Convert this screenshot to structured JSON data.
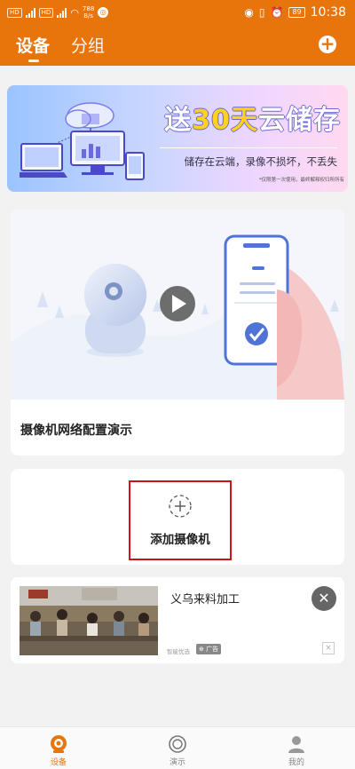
{
  "status_bar": {
    "sim1": "HD",
    "sim2": "HD",
    "net_speed_value": "788",
    "net_speed_unit": "B/s",
    "battery": "89",
    "time": "10:38"
  },
  "header": {
    "tabs": [
      {
        "label": "设备",
        "active": true
      },
      {
        "label": "分组",
        "active": false
      }
    ],
    "accent_color": "#e8740c"
  },
  "banner": {
    "title_prefix": "送",
    "title_highlight": "30天",
    "title_suffix": "云储存",
    "subtitle": "储存在云端，录像不损坏，不丢失",
    "fine_print": "*仅限第一次使用，最终解释权归所所有"
  },
  "demo_card": {
    "caption": "摄像机网络配置演示"
  },
  "add_card": {
    "label": "添加摄像机"
  },
  "ad": {
    "title": "义乌来料加工",
    "source": "智能优选",
    "tag": "广告"
  },
  "bottom_nav": {
    "items": [
      {
        "label": "设备",
        "icon": "camera-icon",
        "active": true
      },
      {
        "label": "演示",
        "icon": "play-circle-icon",
        "active": false
      },
      {
        "label": "我的",
        "icon": "person-icon",
        "active": false
      }
    ]
  }
}
